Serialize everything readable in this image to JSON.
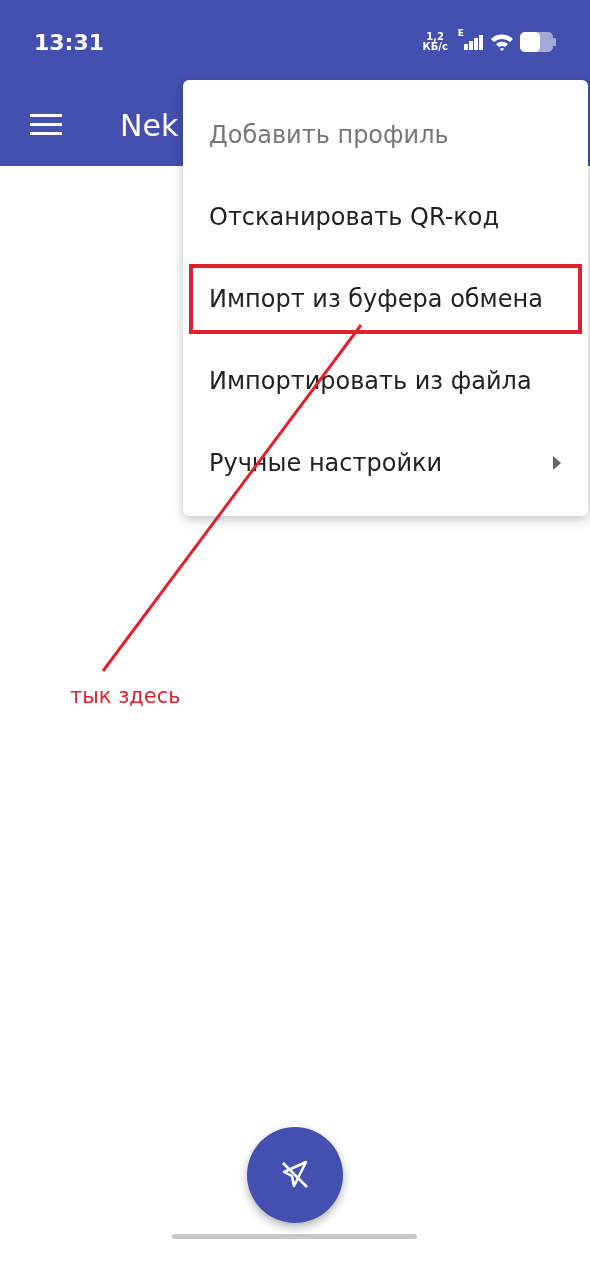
{
  "status_bar": {
    "time": "13:31",
    "speed_value": "1,2",
    "speed_unit": "КБ/с",
    "network": "E"
  },
  "app_bar": {
    "title": "Nek"
  },
  "menu": {
    "items": [
      {
        "kind": "header",
        "label": "Добавить профиль"
      },
      {
        "kind": "item",
        "label": "Отсканировать QR-код",
        "highlighted": false
      },
      {
        "kind": "item",
        "label": "Импорт из буфера обмена",
        "highlighted": true
      },
      {
        "kind": "item",
        "label": "Импортировать из файла",
        "highlighted": false
      },
      {
        "kind": "submenu",
        "label": "Ручные настройки",
        "highlighted": false
      }
    ]
  },
  "annotation": {
    "text": "тык здесь"
  }
}
